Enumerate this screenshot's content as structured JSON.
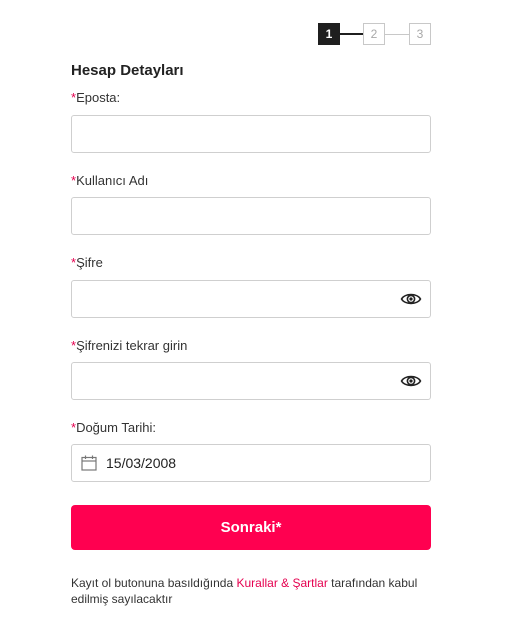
{
  "stepper": {
    "steps": [
      "1",
      "2",
      "3"
    ],
    "active_step": 1
  },
  "form": {
    "title": "Hesap Detayları",
    "required_mark": "*",
    "email": {
      "label": "Eposta:",
      "value": ""
    },
    "username": {
      "label": "Kullanıcı Adı",
      "value": ""
    },
    "password": {
      "label": "Şifre",
      "value": ""
    },
    "password_confirm": {
      "label": "Şifrenizi tekrar girin",
      "value": ""
    },
    "birth_date": {
      "label": "Doğum Tarihi:",
      "value": "15/03/2008"
    }
  },
  "actions": {
    "next_label": "Sonraki*"
  },
  "footer": {
    "text_before": "Kayıt ol butonuna basıldığında ",
    "link_text": "Kurallar & Şartlar",
    "text_after": " tarafından kabul edilmiş sayılacaktır"
  },
  "colors": {
    "accent": "#ff0050",
    "required": "#e5004f",
    "step_active": "#1f1f1f"
  },
  "icons": {
    "eye": "eye-icon",
    "calendar": "calendar-icon"
  }
}
